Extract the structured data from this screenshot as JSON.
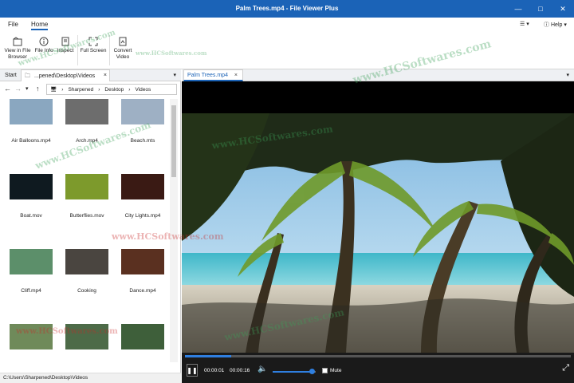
{
  "window": {
    "title": "Palm Trees.mp4 - File Viewer Plus"
  },
  "menu": {
    "file": "File",
    "home": "Home",
    "help": "Help"
  },
  "ribbon": {
    "view_in_browser": "View in File\nBrowser",
    "file_info": "File Info",
    "inspect": "Inspect",
    "full_screen": "Full Screen",
    "convert_video": "Convert\nVideo"
  },
  "left": {
    "tabs": [
      "Start",
      "...pened\\Desktop\\Videos"
    ],
    "crumbs": [
      "Sharpened",
      "Desktop",
      "Videos"
    ],
    "files": [
      {
        "name": "Air Balloons.mp4",
        "color": "#8aa7c0"
      },
      {
        "name": "Arch.mp4",
        "color": "#6d6d6d"
      },
      {
        "name": "Beach.mts",
        "color": "#9eb0c4"
      },
      {
        "name": "Boat.mov",
        "color": "#0f1a20"
      },
      {
        "name": "Butterflies.mov",
        "color": "#7d9a2c"
      },
      {
        "name": "City Lights.mp4",
        "color": "#3a1a14"
      },
      {
        "name": "Cliff.mp4",
        "color": "#5c8f6a"
      },
      {
        "name": "Cooking",
        "color": "#4a4540"
      },
      {
        "name": "Dance.mp4",
        "color": "#5a3020"
      },
      {
        "name": "",
        "color": "#6f8a5a"
      },
      {
        "name": "",
        "color": "#4d6b48"
      },
      {
        "name": "",
        "color": "#3e5f3a"
      }
    ],
    "status": "C:\\Users\\Sharpened\\Desktop\\Videos"
  },
  "right": {
    "tab": "Palm Trees.mp4",
    "time_current": "00:00:01",
    "time_total": "00:00:16",
    "mute_label": "Mute",
    "progress": 0.12,
    "volume": 0.9
  },
  "watermark": "www.HCSoftwares.com"
}
